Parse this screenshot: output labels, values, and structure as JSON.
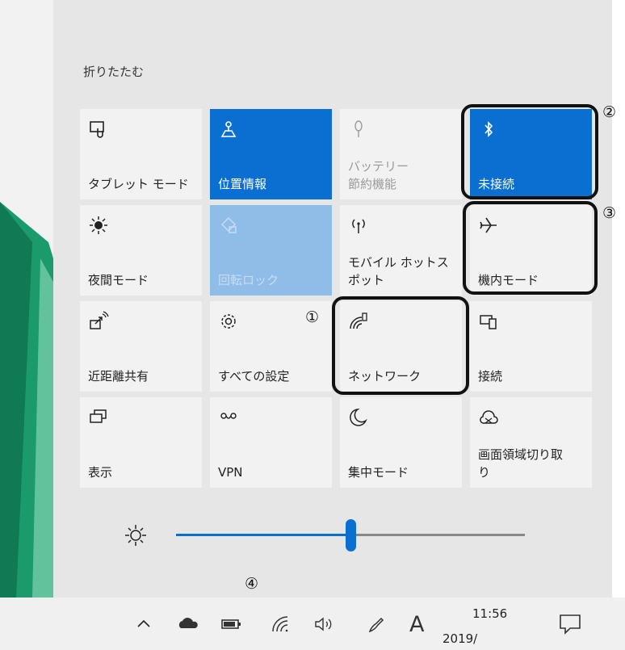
{
  "panel": {
    "collapse_label": "折りたたむ"
  },
  "tiles": [
    {
      "label": "タブレット モード",
      "icon": "tablet-mode-icon",
      "state": "off"
    },
    {
      "label": "位置情報",
      "icon": "location-icon",
      "state": "on"
    },
    {
      "label": "バッテリー\n節約機能",
      "icon": "battery-saver-icon",
      "state": "disabled"
    },
    {
      "label": "未接続",
      "icon": "bluetooth-icon",
      "state": "on"
    },
    {
      "label": "夜間モード",
      "icon": "night-light-icon",
      "state": "off"
    },
    {
      "label": "回転ロック",
      "icon": "rotation-lock-icon",
      "state": "on-disabled"
    },
    {
      "label": "モバイル ホットス\nポット",
      "icon": "mobile-hotspot-icon",
      "state": "off"
    },
    {
      "label": "機内モード",
      "icon": "airplane-icon",
      "state": "off"
    },
    {
      "label": "近距離共有",
      "icon": "nearby-sharing-icon",
      "state": "off"
    },
    {
      "label": "すべての設定",
      "icon": "gear-icon",
      "state": "off"
    },
    {
      "label": "ネットワーク",
      "icon": "network-icon",
      "state": "off"
    },
    {
      "label": "接続",
      "icon": "connect-icon",
      "state": "off"
    },
    {
      "label": "表示",
      "icon": "project-icon",
      "state": "off"
    },
    {
      "label": "VPN",
      "icon": "vpn-icon",
      "state": "off"
    },
    {
      "label": "集中モード",
      "icon": "focus-assist-icon",
      "state": "off"
    },
    {
      "label": "画面領域切り取\nり",
      "icon": "snip-icon",
      "state": "off"
    }
  ],
  "callouts": [
    "①",
    "②",
    "③",
    "④"
  ],
  "brightness": {
    "level_fraction": 0.5
  },
  "taskbar": {
    "time": "11:56",
    "date": "2019/",
    "ime": "A"
  },
  "colors": {
    "accent": "#0a6fd1",
    "tile_bg": "#f2f2f2",
    "panel_bg": "#e6e6e6"
  }
}
